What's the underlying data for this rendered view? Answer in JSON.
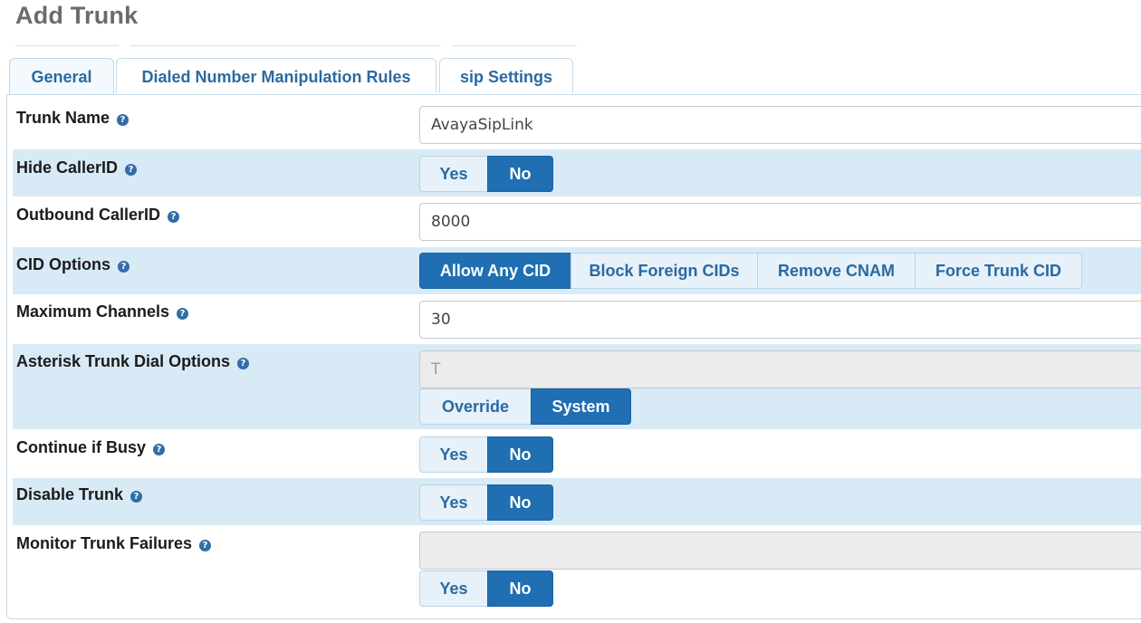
{
  "page": {
    "title": "Add Trunk"
  },
  "tabs": [
    {
      "label": "General",
      "active": true
    },
    {
      "label": "Dialed Number Manipulation Rules",
      "active": false
    },
    {
      "label": "sip Settings",
      "active": false
    }
  ],
  "help_icon_glyph": "?",
  "fields": {
    "trunk_name": {
      "label": "Trunk Name",
      "value": "AvayaSipLink"
    },
    "hide_callerid": {
      "label": "Hide CallerID",
      "options": [
        "Yes",
        "No"
      ],
      "selected": "No"
    },
    "outbound_callerid": {
      "label": "Outbound CallerID",
      "value": "8000"
    },
    "cid_options": {
      "label": "CID Options",
      "options": [
        "Allow Any CID",
        "Block Foreign CIDs",
        "Remove CNAM",
        "Force Trunk CID"
      ],
      "selected": "Allow Any CID"
    },
    "max_channels": {
      "label": "Maximum Channels",
      "value": "30"
    },
    "dial_options": {
      "label": "Asterisk Trunk Dial Options",
      "value": "T",
      "options": [
        "Override",
        "System"
      ],
      "selected": "System"
    },
    "continue_if_busy": {
      "label": "Continue if Busy",
      "options": [
        "Yes",
        "No"
      ],
      "selected": "No"
    },
    "disable_trunk": {
      "label": "Disable Trunk",
      "options": [
        "Yes",
        "No"
      ],
      "selected": "No"
    },
    "monitor_failures": {
      "label": "Monitor Trunk Failures",
      "value": "",
      "options": [
        "Yes",
        "No"
      ],
      "selected": "No"
    }
  },
  "colors": {
    "accent": "#1f6fb2",
    "row_alt": "#d9eaf7",
    "tab_text": "#2a6aa1"
  }
}
